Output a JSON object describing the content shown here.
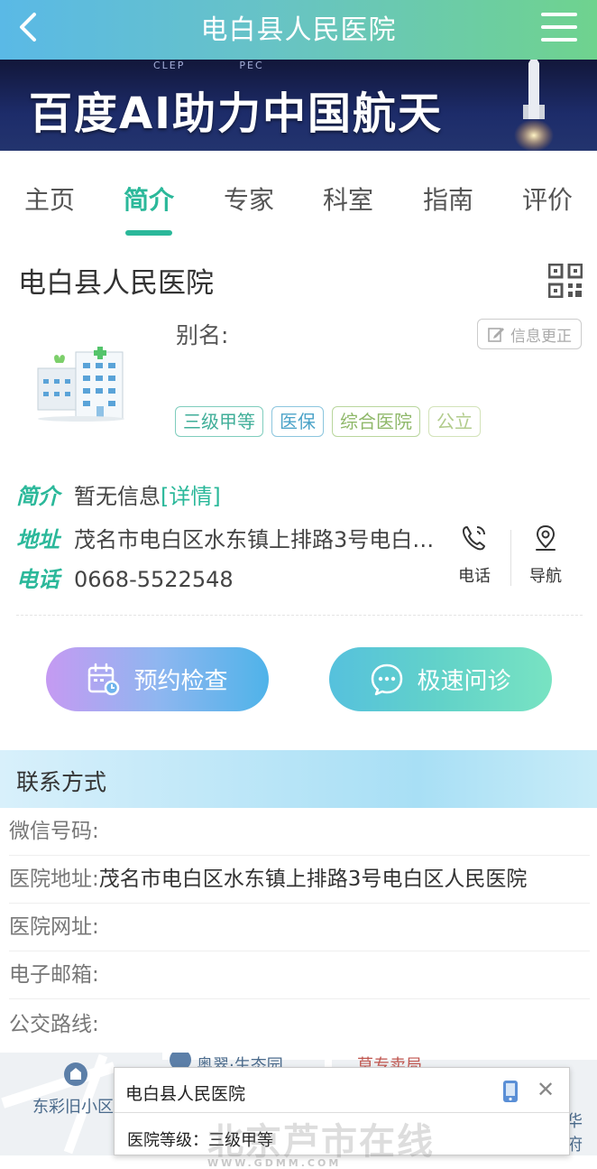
{
  "header": {
    "title": "电白县人民医院"
  },
  "banner": {
    "headline": "百度AI助力中国航天",
    "logo_left": "CLEP",
    "logo_right": "PEC"
  },
  "tabs": [
    {
      "label": "主页"
    },
    {
      "label": "简介",
      "active": true
    },
    {
      "label": "专家"
    },
    {
      "label": "科室"
    },
    {
      "label": "指南"
    },
    {
      "label": "评价"
    }
  ],
  "hospital": {
    "name": "电白县人民医院",
    "alias_label": "别名:",
    "correct_label": "信息更正",
    "tags": [
      {
        "label": "三级甲等",
        "color": "#3fae98"
      },
      {
        "label": "医保",
        "color": "#4ba3c8"
      },
      {
        "label": "综合医院",
        "color": "#8fb86a"
      },
      {
        "label": "公立",
        "color": "#b2cc8c"
      }
    ]
  },
  "info": {
    "intro_label": "简介",
    "intro_value": "暂无信息",
    "intro_link": "[详情]",
    "address_label": "地址",
    "address_value": "茂名市电白区水东镇上排路3号电白…",
    "phone_label": "电话",
    "phone_value": "0668-5522548",
    "call_label": "电话",
    "nav_label": "导航"
  },
  "actions": {
    "book_label": "预约检查",
    "consult_label": "极速问诊"
  },
  "contact": {
    "heading": "联系方式",
    "rows": [
      {
        "label": "微信号码:",
        "value": ""
      },
      {
        "label": "医院地址:",
        "value": "茂名市电白区水东镇上排路3号电白区人民医院"
      },
      {
        "label": "医院网址:",
        "value": ""
      },
      {
        "label": "电子邮箱:",
        "value": ""
      },
      {
        "label": "公交路线:",
        "value": ""
      }
    ]
  },
  "map": {
    "places": [
      "东彩旧小区",
      "华府"
    ],
    "poi": [
      "奥翠·生态园",
      "草专卖局"
    ],
    "popup_title": "电白县人民医院",
    "popup_grade": "医院等级：三级甲等"
  },
  "watermark": {
    "text": "北京芦市在线",
    "sub": "WWW.GDMM.COM"
  },
  "colors": {
    "accent": "#2bb89a"
  }
}
